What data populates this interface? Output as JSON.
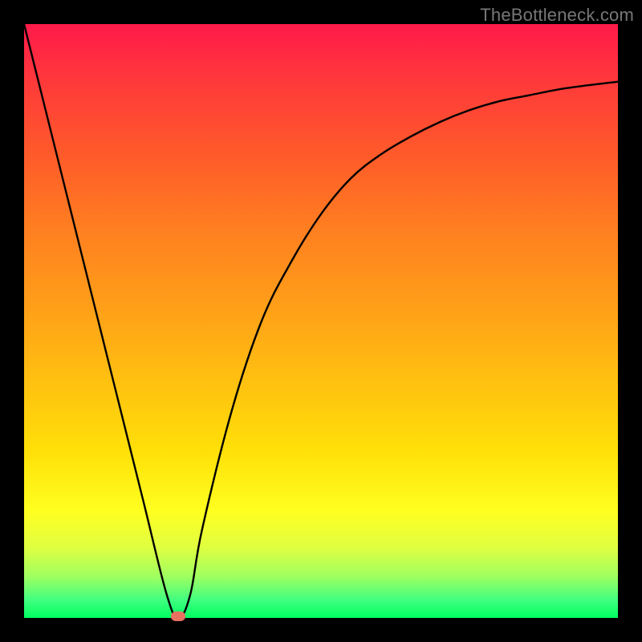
{
  "watermark": "TheBottleneck.com",
  "chart_data": {
    "type": "line",
    "title": "",
    "xlabel": "",
    "ylabel": "",
    "xlim": [
      0,
      100
    ],
    "ylim": [
      0,
      100
    ],
    "grid": false,
    "legend": false,
    "series": [
      {
        "name": "bottleneck-curve",
        "x": [
          0,
          5,
          10,
          15,
          20,
          24,
          26,
          28,
          30,
          35,
          40,
          45,
          50,
          55,
          60,
          65,
          70,
          75,
          80,
          85,
          90,
          95,
          100
        ],
        "y": [
          100,
          80,
          60,
          40,
          20,
          4,
          0,
          4,
          15,
          35,
          50,
          60,
          68,
          74,
          78,
          81,
          83.5,
          85.5,
          87,
          88,
          89,
          89.7,
          90.3
        ]
      }
    ],
    "marker": {
      "x": 26,
      "y": 0,
      "color": "#e87060"
    },
    "background_gradient": {
      "stops": [
        {
          "pos": 0.0,
          "color": "#ff1a4a"
        },
        {
          "pos": 0.5,
          "color": "#ffa018"
        },
        {
          "pos": 0.82,
          "color": "#ffff20"
        },
        {
          "pos": 1.0,
          "color": "#00ff60"
        }
      ]
    }
  }
}
